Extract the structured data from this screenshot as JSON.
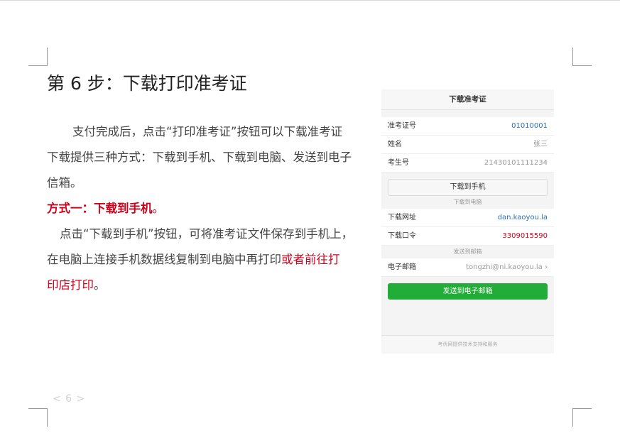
{
  "title": "第 6 步：下载打印准考证",
  "body": {
    "p1_l1": "支付完成后，点击“打印准考证”按钮可以下载准考证",
    "p1_l2": "下载提供三种方式：下载到手机、下载到电脑、发送到电子",
    "p1_l3": "信箱。",
    "method_label": "方式一：下载到手机",
    "method_period": "。",
    "p2_l1": "点击“下载到手机”按钮，可将准考证文件保存到手机上，",
    "p2_l2_black": "在电脑上连接手机数据线复制到电脑中再打印",
    "p2_l2_red": "或者前往打",
    "p2_l3_red": "印店打印",
    "p2_l3_period": "。"
  },
  "page_number": "< 6 >",
  "phone": {
    "header": "下载准考证",
    "rows": [
      {
        "label": "准考证号",
        "value": "01010001"
      },
      {
        "label": "姓名",
        "value": "张三"
      },
      {
        "label": "考生号",
        "value": "21430101111234"
      }
    ],
    "download_button": "下载到手机",
    "pc_caption": "下载到电脑",
    "url_label": "下载网址",
    "url_value": "dan.kaoyou.la",
    "code_label": "下载口令",
    "code_value": "3309015590",
    "email_caption": "发送到邮箱",
    "email_label": "电子邮箱",
    "email_value": "tongzhi@ni.kaoyou.la",
    "send_button": "发送到电子邮箱",
    "footer": "考优网提供技术支持和服务"
  },
  "colors": {
    "accent_red": "#d0021b",
    "link_blue": "#2a6ebb",
    "green": "#22ac38"
  }
}
